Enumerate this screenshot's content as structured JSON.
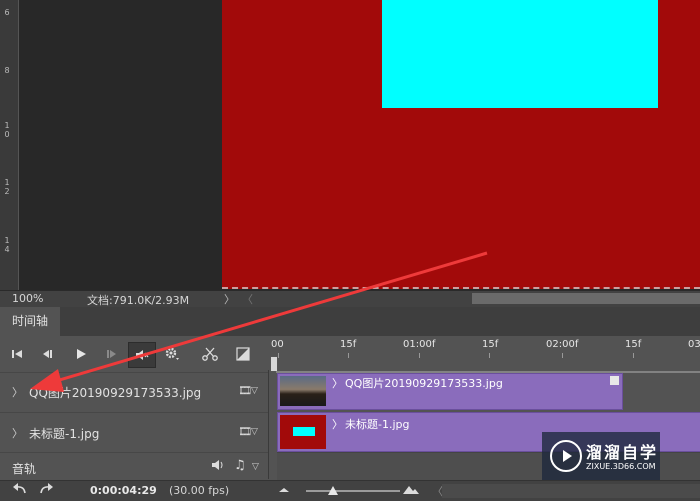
{
  "canvas": {
    "ruler_labels": [
      "6",
      "8",
      "1\n0",
      "1\n2",
      "1\n4"
    ],
    "doc_color": "#a20a0a",
    "shape_color": "#00ffff"
  },
  "status_bar": {
    "zoom": "100%",
    "doc_info": "文档:791.0K/2.93M",
    "arrow": "〉",
    "arrow_left": "〈"
  },
  "panel": {
    "tab_label": "时间轴"
  },
  "controls": {
    "first_frame": "first-frame-icon",
    "prev_frame": "prev-frame-icon",
    "play": "play-icon",
    "next_frame": "next-frame-icon",
    "audio": "audio-mute-icon",
    "settings": "gear-icon",
    "split": "scissors-icon",
    "transition": "transition-icon"
  },
  "ruler": {
    "labels": [
      "00",
      "15f",
      "01:00f",
      "15f",
      "02:00f",
      "15f",
      "03"
    ]
  },
  "layers": [
    {
      "name": "QQ图片20190929173533.jpg",
      "clip_label": "QQ图片20190929173533.jpg"
    },
    {
      "name": "未标题-1.jpg",
      "clip_label": "未标题-1.jpg"
    }
  ],
  "audio_track": {
    "label": "音轨"
  },
  "bottom_bar": {
    "timecode": "0:00:04:29",
    "fps": "(30.00 fps)"
  },
  "watermark": {
    "title": "溜溜自学",
    "subtitle": "ZIXUE.3D66.COM"
  },
  "colors": {
    "clip": "#8a6cbc",
    "annotation_arrow": "#ee3a3a"
  }
}
